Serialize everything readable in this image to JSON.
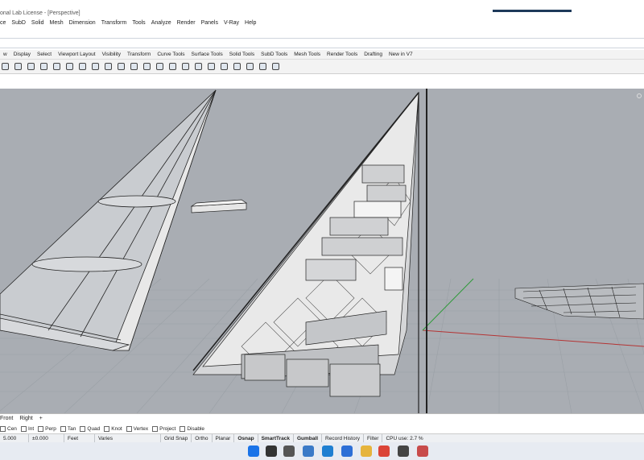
{
  "window": {
    "title": "onal Lab License - [Perspective]"
  },
  "menu": [
    "ce",
    "SubD",
    "Solid",
    "Mesh",
    "Dimension",
    "Transform",
    "Tools",
    "Analyze",
    "Render",
    "Panels",
    "V-Ray",
    "Help"
  ],
  "toolbar_tabs": [
    "w",
    "Display",
    "Select",
    "Viewport Layout",
    "Visibility",
    "Transform",
    "Curve Tools",
    "Surface Tools",
    "Solid Tools",
    "SubD Tools",
    "Mesh Tools",
    "Render Tools",
    "Drafting",
    "New in V7"
  ],
  "toolbar_icons": [
    "zoom-icon",
    "rotate-icon",
    "pan-icon",
    "view-icon",
    "select-icon",
    "window-icon",
    "render-icon",
    "box-icon",
    "folder-icon",
    "move-icon",
    "layer-icon",
    "properties-icon",
    "curve-icon",
    "eye-icon",
    "light-icon",
    "camera-icon",
    "grid-icon",
    "snap-icon",
    "ortho-icon",
    "plane-icon",
    "ray-icon",
    "sphere-icon"
  ],
  "view_tabs": [
    "Front",
    "Right",
    "+"
  ],
  "osnaps": [
    {
      "label": "Cen"
    },
    {
      "label": "Int"
    },
    {
      "label": "Perp"
    },
    {
      "label": "Tan"
    },
    {
      "label": "Quad"
    },
    {
      "label": "Knot"
    },
    {
      "label": "Vertex"
    },
    {
      "label": "Project"
    },
    {
      "label": "Disable"
    }
  ],
  "status": {
    "coord": "5.000",
    "coord2": "±0.000",
    "units": "Feet",
    "layer": "Varies",
    "panes": [
      "Grid Snap",
      "Ortho",
      "Planar",
      "Osnap",
      "SmartTrack",
      "Gumball",
      "Record History",
      "Filter"
    ],
    "cpu": "CPU use: 2.7 %"
  },
  "colors": {
    "viewport_bg": "#a9adb3",
    "grid": "#8e9298",
    "axis_red": "#b43434",
    "axis_green": "#2f9a3a",
    "taskbar_bg": "#e7ebf2"
  },
  "taskbar_icons": [
    "windows-start-icon",
    "search-icon",
    "task-view-icon",
    "widgets-icon",
    "edge-icon",
    "store-icon",
    "explorer-icon",
    "chrome-icon",
    "rhino-icon",
    "plugin-icon"
  ]
}
